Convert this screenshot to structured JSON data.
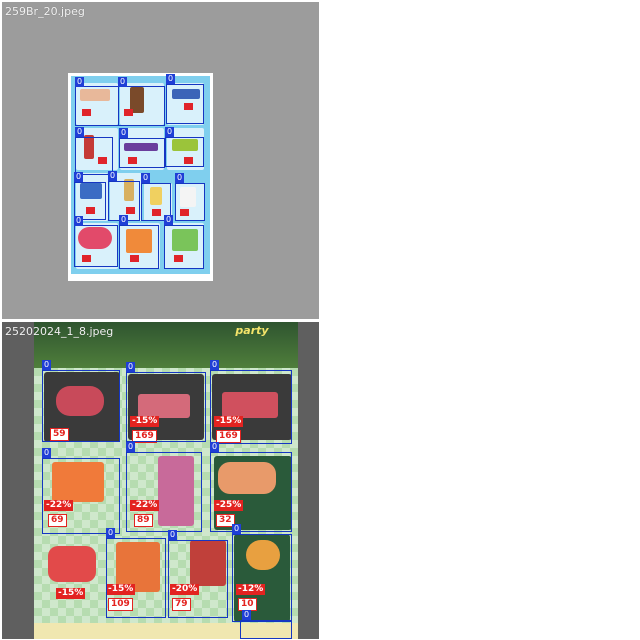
{
  "tiles": [
    {
      "filename": "259Br_20.jpeg",
      "detections": [
        {
          "label": "0"
        },
        {
          "label": "0"
        },
        {
          "label": "0"
        },
        {
          "label": "0"
        },
        {
          "label": "0"
        },
        {
          "label": "0"
        },
        {
          "label": "0"
        },
        {
          "label": "0"
        },
        {
          "label": "0"
        },
        {
          "label": "0"
        },
        {
          "label": "0"
        },
        {
          "label": "0"
        },
        {
          "label": "0"
        }
      ]
    },
    {
      "filename": "25202024_1_8.jpeg",
      "header_text": "party",
      "detections": [
        {
          "label": "0"
        },
        {
          "label": "0"
        },
        {
          "label": "0"
        },
        {
          "label": "0"
        },
        {
          "label": "0"
        },
        {
          "label": "0"
        },
        {
          "label": "0"
        },
        {
          "label": "0"
        },
        {
          "label": "0"
        },
        {
          "label": "0"
        },
        {
          "label": "0"
        }
      ],
      "price_tags": [
        {
          "discount": "",
          "price": "59"
        },
        {
          "discount": "-15%",
          "price": "169"
        },
        {
          "discount": "-15%",
          "price": "169"
        },
        {
          "discount": "-22%",
          "price": "69"
        },
        {
          "discount": "-22%",
          "price": "89"
        },
        {
          "discount": "-25%",
          "price": "32"
        },
        {
          "discount": "-15%",
          "price": ""
        },
        {
          "discount": "-15%",
          "price": "109"
        },
        {
          "discount": "-20%",
          "price": "79"
        },
        {
          "discount": "-12%",
          "price": "10"
        }
      ]
    }
  ],
  "colors": {
    "box": "#1536c2",
    "tag": "#1f3fd6",
    "leaflet1_bg": "#7fcfee",
    "leaflet2_bg": "#b6dcb0"
  }
}
